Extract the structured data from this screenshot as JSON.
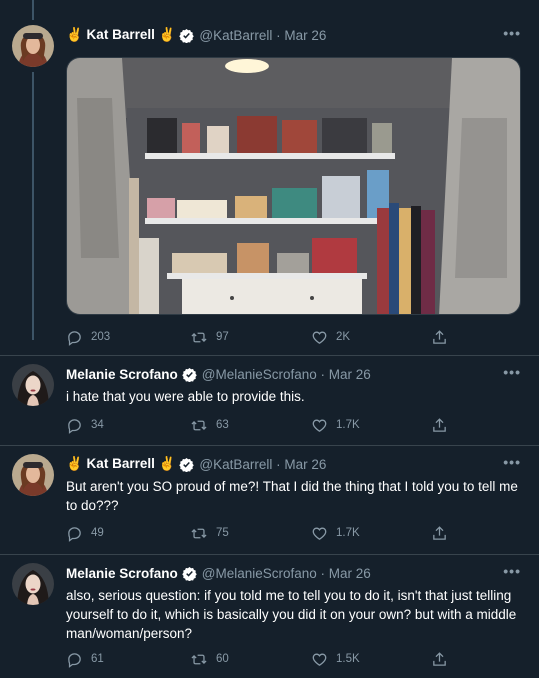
{
  "colors": {
    "background": "#15202b",
    "text_primary": "#ffffff",
    "text_secondary": "#8899a6",
    "divider": "#38444d",
    "verified_badge": "#ffffff"
  },
  "tweets": [
    {
      "name": "✌️ Kat Barrell ✌️",
      "handle": "@KatBarrell · Mar 26",
      "text": "",
      "has_media": true,
      "media_description_icon": "closet-photo",
      "replies": "203",
      "retweets": "97",
      "likes": "2K"
    },
    {
      "name": "Melanie Scrofano",
      "handle": "@MelanieScrofano · Mar 26",
      "text": "i hate that you were able to provide this.",
      "replies": "34",
      "retweets": "63",
      "likes": "1.7K"
    },
    {
      "name": "✌️ Kat Barrell ✌️",
      "handle": "@KatBarrell · Mar 26",
      "text": "But aren't you SO proud of me?! That I did the thing that I told you to tell me to do???",
      "replies": "49",
      "retweets": "75",
      "likes": "1.7K"
    },
    {
      "name": "Melanie Scrofano",
      "handle": "@MelanieScrofano · Mar 26",
      "text": "also, serious question: if you told me to tell you to do it, isn't that just telling yourself to do it, which is basically you did it on your own? but with a middle man/woman/person?",
      "replies": "61",
      "retweets": "60",
      "likes": "1.5K"
    }
  ],
  "more_label": "•••"
}
